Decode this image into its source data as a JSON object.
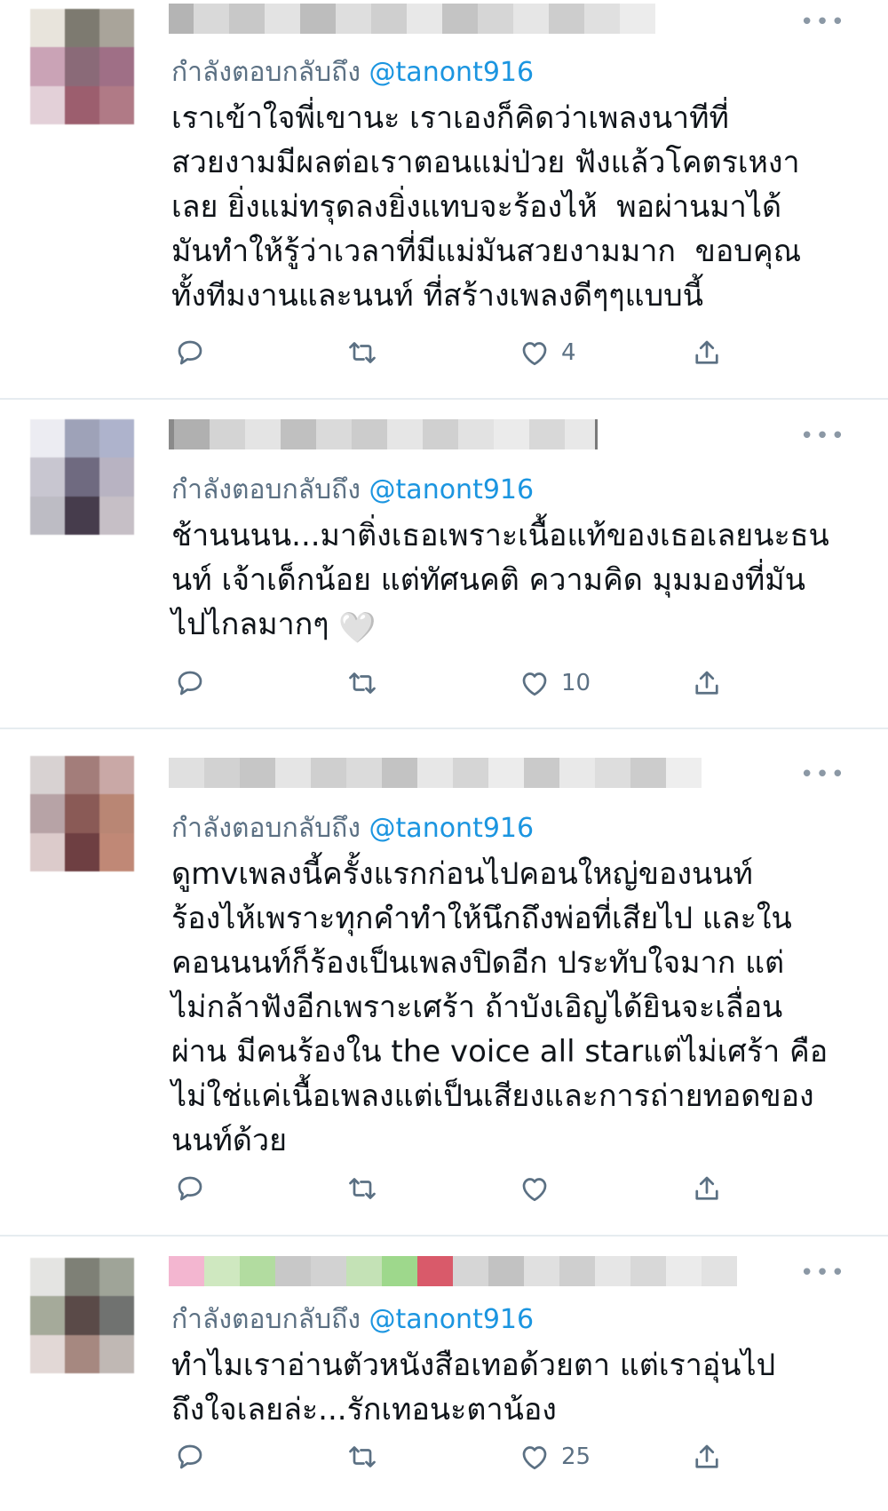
{
  "colors": {
    "handle": "#1b95e0",
    "muted": "#5b7083",
    "text": "#0f1419",
    "divider": "#e6ecf0"
  },
  "icons": {
    "reply": "reply-icon",
    "retweet": "retweet-icon",
    "like": "like-icon",
    "share": "share-icon",
    "more": "more-icon"
  },
  "tweets": [
    {
      "more": "•••",
      "reply_prefix": "กำลังตอบกลับถึง",
      "reply_handle": "@tanont916",
      "text": "เราเข้าใจพี่เขานะ เราเองก็คิดว่าเพลงนาทีที่\nสวยงามมีผลต่อเราตอนแม่ป่วย ฟังแล้วโคตรเหงา\nเลย ยิ่งแม่ทรุดลงยิ่งแทบจะร้องไห้  พอผ่านมาได้\nมันทำให้รู้ว่าเวลาที่มีแม่มันสวยงามมาก  ขอบคุณ\nทั้งทีมงานและนนท์ ที่สร้างเพลงดีๆๆแบบนี้",
      "likes": "4"
    },
    {
      "more": "•••",
      "reply_prefix": "กำลังตอบกลับถึง",
      "reply_handle": "@tanont916",
      "text": "ช้านนนน...มาติ่งเธอเพราะเนื้อแท้ของเธอเลยนะธน\nนท์ เจ้าเด็กน้อย แต่ทัศนคติ ความคิด มุมมองที่มัน\nไปไกลมากๆ",
      "emoji": "🤍",
      "likes": "10"
    },
    {
      "more": "•••",
      "reply_prefix": "กำลังตอบกลับถึง",
      "reply_handle": "@tanont916",
      "text": "ดูmvเพลงนี้ครั้งแรกก่อนไปคอนใหญ่ของนนท์\nร้องไห้เพราะทุกคำทำให้นึกถึงพ่อที่เสียไป และใน\nคอนนนท์ก็ร้องเป็นเพลงปิดอีก ประทับใจมาก แต่\nไม่กล้าฟังอีกเพราะเศร้า ถ้าบังเอิญได้ยินจะเลื่อน\nผ่าน มีคนร้องใน the voice all starแต่ไม่เศร้า คือ\nไม่ใช่แค่เนื้อเพลงแต่เป็นเสียงและการถ่ายทอดของ\nนนท์ด้วย",
      "likes": ""
    },
    {
      "more": "•••",
      "reply_prefix": "กำลังตอบกลับถึง",
      "reply_handle": "@tanont916",
      "text": "ทำไมเราอ่านตัวหนังสือเทอด้วยตา แต่เราอุ่นไป\nถึงใจเลยล่ะ...รักเทอนะตาน้อง",
      "likes": "25"
    }
  ]
}
